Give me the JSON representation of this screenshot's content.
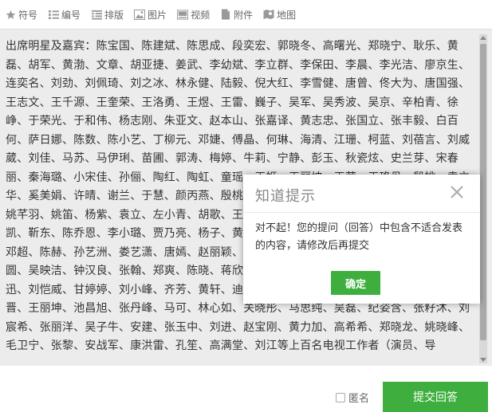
{
  "toolbar": {
    "items": [
      {
        "label": "符号",
        "icon": "star-icon"
      },
      {
        "label": "编号",
        "icon": "numbered-list-icon"
      },
      {
        "label": "排版",
        "icon": "layout-icon"
      },
      {
        "label": "图片",
        "icon": "image-icon"
      },
      {
        "label": "视频",
        "icon": "video-icon"
      },
      {
        "label": "附件",
        "icon": "attachment-icon"
      },
      {
        "label": "地图",
        "icon": "map-icon"
      }
    ]
  },
  "editor": {
    "content": "出席明星及嘉宾：陈宝国、陈建斌、陈思成、段奕宏、郭晓冬、高曙光、郑晓宁、耿乐、黄磊、胡军、黄渤、文章、胡亚捷、姜武、李幼斌、李立群、李保田、李晨、李光洁、廖京生、连奕名、刘劲、刘佩琦、刘之冰、林永健、陆毅、倪大红、李雪健、唐曾、佟大为、唐国强、王志文、王千源、王奎荣、王洛勇、王煜、王雷、巍子、吴军、吴秀波、吴京、辛柏青、徐峥、于荣光、于和伟、杨志刚、朱亚文、赵本山、张嘉译、黄志忠、张国立、张丰毅、白百何、萨日娜、陈数、陈小艺、丁柳元、邓婕、傅晶、何琳、海清、江珊、柯蓝、刘蓓言、刘威葳、刘佳、马苏、马伊琍、苗圃、郭涛、梅婷、牛莉、宁静、彭玉、秋瓷炫、史兰芽、宋春丽、秦海璐、小宋佳、孙俪、陶红、陶虹、童瑶、王姬、王丽坤、王茜、王珞丹、殷桃、袁立华、奚美娟、许晴、谢兰、于慧、颜丙燕、殷桃、闫妮、杨幂、王丽坤、刘涛、蒋欣、闫妮、姚芊羽、姚笛、杨紫、袁立、左小青、胡歌、王凯、黄轩、刘昊然、杨洋、张一山、于宇、王凯、靳东、陈乔恩、李小璐、贾乃亮、杨子、黄圣依、林心如、霍建华、杨幂、刘恺威、新、邓超、陈赫、孙艺洲、娄艺潇、唐嫣、赵丽颖、冯绍峰、钟汉良、郑恺、王宝强、刘雯、马圆、吴映洁、钟汉良、张翰、郑爽、陈晓、蒋欣、李沁、王子文、金晨、何润东、刘嘉玲、迅、刘恺威、甘婷婷、刘小峰、齐芳、黄轩、迪丽热巴、朱亚文、陈坤、杨紫、关晓彤、罗晋、王丽坤、池昌旭、张丹峰、马可、林心如、关晓彤、马思纯、吴磊、纪姿含、张籽沐、刘宸希、张丽洋、吴子牛、安建、张玉中、刘进、赵宝刚、黄力加、高希希、郑晓龙、姚晓峰、毛卫宁、张黎、安战军、康洪雷、孔笙、高满堂、刘江等上百名电视工作者（演员、导"
  },
  "footer": {
    "anonymous_label": "匿名",
    "submit_label": "提交回答"
  },
  "dialog": {
    "title": "知道提示",
    "message": "对不起！您的提问（回答）中包含不适合发表的内容，请修改后再提交",
    "confirm_label": "确定"
  },
  "colors": {
    "accent": "#3eaf3e",
    "editor_bg": "#ececec"
  }
}
